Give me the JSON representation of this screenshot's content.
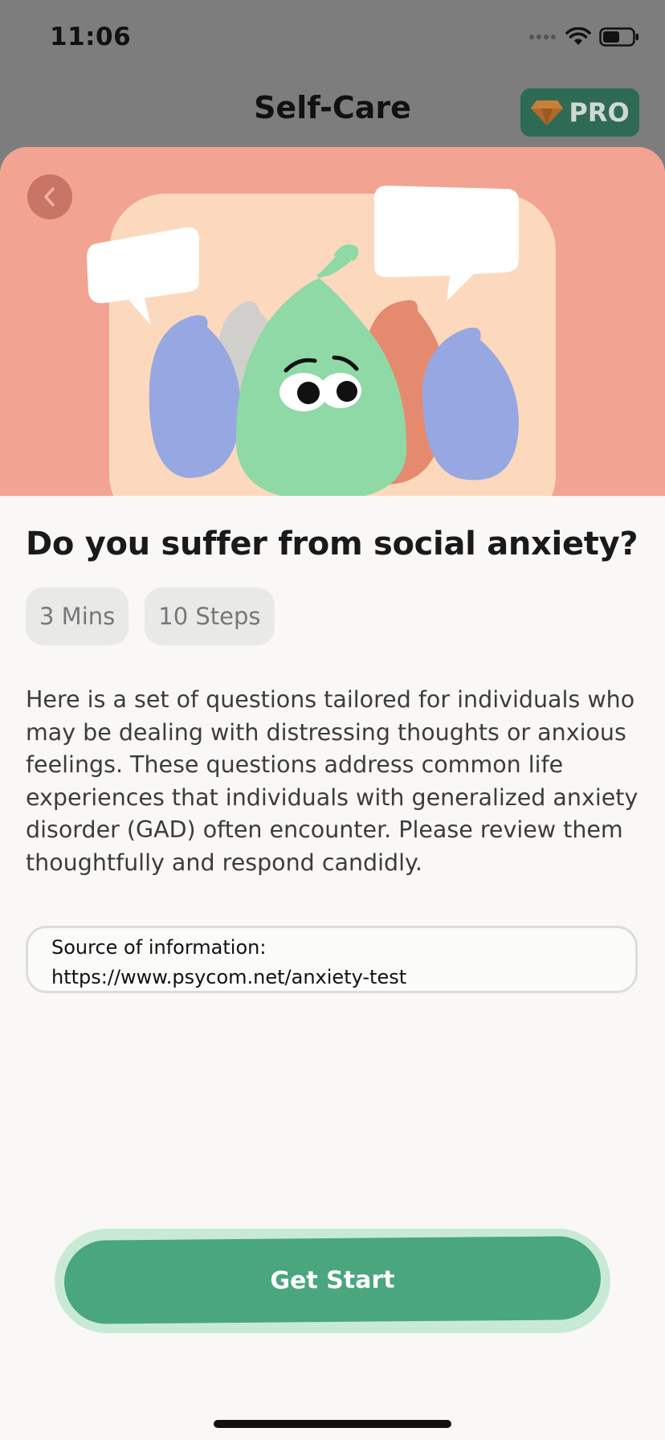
{
  "status_bar": {
    "time": "11:06"
  },
  "header": {
    "title": "Self-Care",
    "pro_label": "PRO"
  },
  "sheet": {
    "title": "Do you suffer from social anxiety?",
    "chips": [
      "3 Mins",
      "10 Steps"
    ],
    "description": "Here is a set of questions tailored for individuals who may be dealing with distressing thoughts or anxious feelings. These questions address common life experiences that individuals with generalized anxiety disorder (GAD) often encounter. Please review them thoughtfully and respond candidly.",
    "source_label": "Source of information:",
    "source_url": "https://www.psycom.net/anxiety-test",
    "start_button": "Get Start"
  },
  "icons": {
    "back": "chevron-left-icon",
    "pro": "diamond-icon",
    "signal": "signal-icon",
    "wifi": "wifi-icon",
    "battery": "battery-icon"
  },
  "colors": {
    "hero_background": "#f2a392",
    "primary_green": "#49a67f",
    "pro_badge": "#2f6a55",
    "overlay_dim": "#7d7d7d"
  }
}
